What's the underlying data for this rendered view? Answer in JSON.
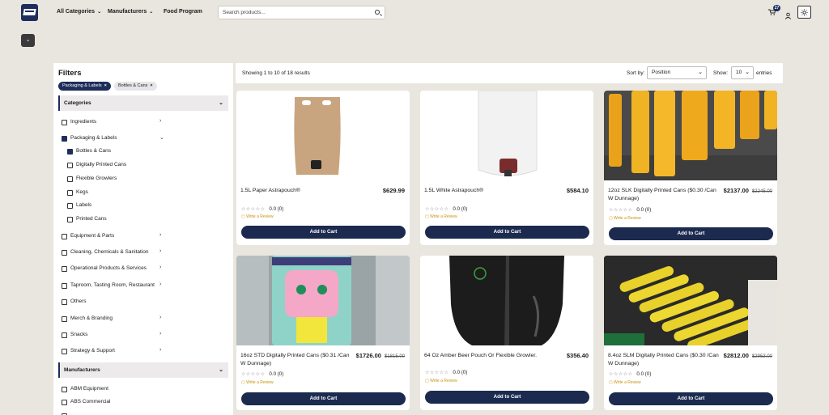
{
  "header": {
    "nav": [
      "All Categories",
      "Manufacturers",
      "Food Program"
    ],
    "search_placeholder": "Search products...",
    "cart_count": "27"
  },
  "sidebar": {
    "title": "Filters",
    "chips": [
      "Packaging & Labels",
      "Bottles & Cans"
    ],
    "categories_head": "Categories",
    "categories": [
      "Ingredients",
      "Packaging & Labels",
      "Equipment & Parts",
      "Cleaning, Chemicals & Sanitation",
      "Operational Products & Services",
      "Taproom, Tasting Room, Restaurant",
      "Others",
      "Merch & Branding",
      "Snacks",
      "Strategy & Support"
    ],
    "subcategories": [
      "Bottles & Cans",
      "Digitally Printed Cans",
      "Flexible Growlers",
      "Kegs",
      "Labels",
      "Printed Cans"
    ],
    "manufacturers_head": "Manufacturers",
    "manufacturers": [
      "ABM Equipment",
      "ABS Commercial"
    ]
  },
  "results": {
    "showing": "Showing 1 to 10 of 18 results",
    "sort_label": "Sort by:",
    "sort_value": "Position",
    "show_label": "Show:",
    "show_value": "10",
    "entries_label": "entries"
  },
  "products": [
    {
      "name": "1.5L Paper Astrapouch®",
      "price": "$629.99",
      "old_price": "",
      "rating": "0.0 (0)",
      "review": "Write a Review",
      "button": "Add to Cart"
    },
    {
      "name": "1.5L White Astrapouch®",
      "price": "$584.10",
      "old_price": "",
      "rating": "0.0 (0)",
      "review": "Write a Review",
      "button": "Add to Cart"
    },
    {
      "name": "12oz SLK Digitally Printed Cans ($0.30 /Can W Dunnage)",
      "price": "$2137.00",
      "old_price": "$2245.00",
      "rating": "0.0 (0)",
      "review": "Write a Review",
      "button": "Add to Cart"
    },
    {
      "name": "16oz STD Digitally Printed Cans ($0.31 /Can W Dunnage)",
      "price": "$1726.00",
      "old_price": "$1815.00",
      "rating": "0.0 (0)",
      "review": "Write a Review",
      "button": "Add to Cart"
    },
    {
      "name": "64 Oz Amber Beer Pouch Or Flexible Growler.",
      "price": "$356.40",
      "old_price": "",
      "rating": "0.0 (0)",
      "review": "Write a Review",
      "button": "Add to Cart"
    },
    {
      "name": "8.4oz SLM Digitally Printed Cans ($0.30 /Can W Dunnage)",
      "price": "$2812.00",
      "old_price": "$2953.00",
      "rating": "0.0 (0)",
      "review": "Write a Review",
      "button": "Add to Cart"
    }
  ],
  "colors": {
    "brand": "#1f2d5a",
    "review": "#c9920b",
    "background": "#e9e5df"
  }
}
